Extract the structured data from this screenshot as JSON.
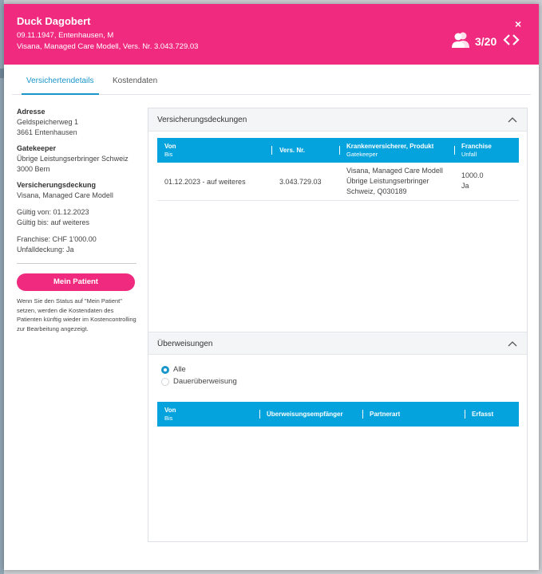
{
  "header": {
    "name": "Duck Dagobert",
    "line1": "09.11.1947, Entenhausen, M",
    "line2": "Visana, Managed Care Modell, Vers. Nr. 3.043.729.03",
    "counter": "3/20",
    "close_label": "×",
    "patients_icon": "users-icon",
    "nav_icon": "chevron-left-right-icon",
    "color": "#ef2a7f"
  },
  "tabs": [
    {
      "label": "Versichertendetails",
      "active": true
    },
    {
      "label": "Kostendaten",
      "active": false
    }
  ],
  "sidebar": {
    "adresse_label": "Adresse",
    "adresse_lines": [
      "Geldspeicherweg 1",
      "3661 Entenhausen"
    ],
    "gatekeeper_label": "Gatekeeper",
    "gatekeeper_lines": [
      "Übrige Leistungserbringer Schweiz",
      "3000 Bern"
    ],
    "deckung_label": "Versicherungsdeckung",
    "deckung_lines": [
      "Visana, Managed Care Modell"
    ],
    "gueltig_lines": [
      "Gültig von: 01.12.2023",
      "Gültig bis: auf weiteres"
    ],
    "franchise_lines": [
      "Franchise: CHF 1'000.00",
      "Unfalldeckung: Ja"
    ],
    "button_label": "Mein Patient",
    "note": "Wenn Sie den Status auf \"Mein Patient\" setzen, werden die Kostendaten des Patienten künftig wieder im Kostencontrolling zur Bearbeitung angezeigt."
  },
  "versicherungsdeckungen": {
    "title": "Versicherungsdeckungen",
    "columns": [
      {
        "main": "Von",
        "sub": "Bis"
      },
      {
        "main": "Vers. Nr.",
        "sub": ""
      },
      {
        "main": "Krankenversicherer, Produkt",
        "sub": "Gatekeeper"
      },
      {
        "main": "Franchise",
        "sub": "Unfall"
      }
    ],
    "rows": [
      {
        "von_bis": "01.12.2023 - auf weiteres",
        "vers_nr": "3.043.729.03",
        "versicherer_lines": [
          "Visana, Managed Care Modell",
          "Übrige Leistungserbringer",
          "Schweiz, Q030189"
        ],
        "franchise": "1000.0",
        "unfall": "Ja"
      }
    ]
  },
  "ueberweisungen": {
    "title": "Überweisungen",
    "radio_options": [
      {
        "label": "Alle",
        "selected": true
      },
      {
        "label": "Dauerüberweisung",
        "selected": false
      }
    ],
    "columns": [
      {
        "main": "Von",
        "sub": "Bis"
      },
      {
        "main": "Überweisungsempfänger",
        "sub": ""
      },
      {
        "main": "Partnerart",
        "sub": ""
      },
      {
        "main": "Erfasst",
        "sub": ""
      }
    ]
  },
  "colors": {
    "accent": "#1a95c9",
    "table_header": "#04a3dd",
    "pink": "#ef2a7f"
  }
}
